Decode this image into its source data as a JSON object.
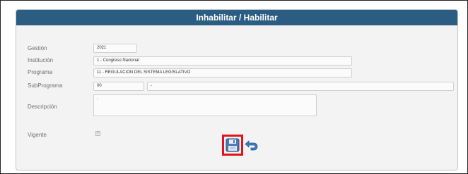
{
  "form": {
    "title": "Inhabilitar / Habilitar",
    "labels": {
      "gestion": "Gestión",
      "institucion": "Institución",
      "programa": "Programa",
      "subprograma": "SubPrograma",
      "descripcion": "Descripción",
      "vigente": "Vigente"
    },
    "values": {
      "gestion": "2021",
      "institucion": "1 - Congreso Nacional",
      "programa": "11 - REGULACION DEL SISTEMA LEGISLATIVO",
      "subprograma_code": "00",
      "subprograma_name": "-",
      "descripcion": "-",
      "vigente_checked": true
    }
  },
  "actions": {
    "save_icon": "save-disk-icon",
    "back_icon": "undo-arrow-icon",
    "save_highlight_color": "#e0141a",
    "accent_color": "#2b5c82"
  }
}
